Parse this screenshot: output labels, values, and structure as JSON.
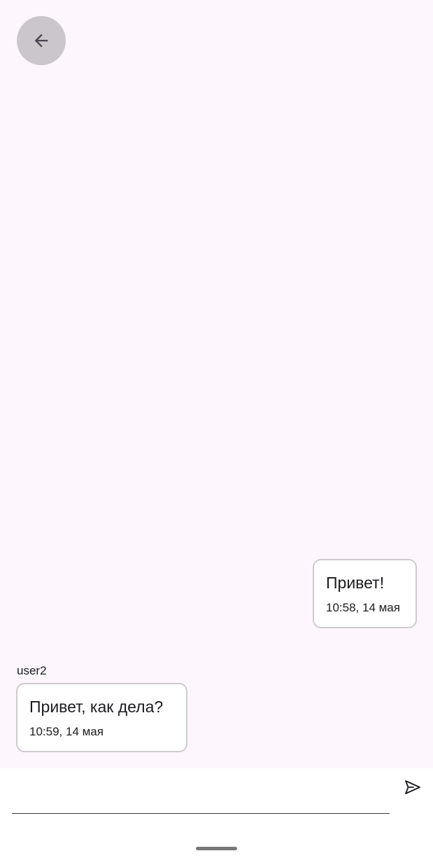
{
  "header": {
    "back_icon": "arrow-left-icon"
  },
  "messages": [
    {
      "direction": "outgoing",
      "sender": "",
      "text": "Привет!",
      "time": "10:58, 14 мая"
    },
    {
      "direction": "incoming",
      "sender": "user2",
      "text": "Привет, как дела?",
      "time": "10:59, 14 мая"
    }
  ],
  "composer": {
    "input_value": "",
    "input_placeholder": "",
    "send_icon": "send-icon"
  },
  "colors": {
    "background": "#fdf6fd",
    "bubble_background": "#ffffff",
    "bubble_border": "#cfcacf",
    "back_button": "#cbc6cc",
    "text": "#1c1b1f"
  }
}
